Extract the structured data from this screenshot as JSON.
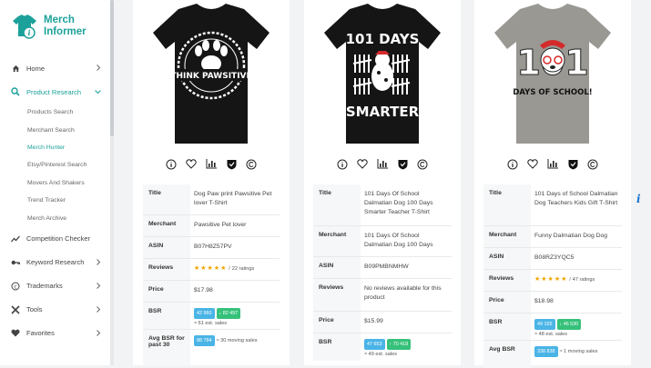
{
  "brand": {
    "line1": "Merch",
    "line2": "Informer",
    "color": "#1ba19a"
  },
  "nav": {
    "home": "Home",
    "product_research": "Product Research",
    "sub": [
      "Products Search",
      "Merchant Search",
      "Merch Hunter",
      "Etsy/Pinterest Search",
      "Movers And Shakers",
      "Trend Tracker",
      "Merch Archive"
    ],
    "competition": "Competition Checker",
    "keyword": "Keyword Research",
    "trademarks": "Trademarks",
    "tools": "Tools",
    "favorites": "Favorites"
  },
  "labels": {
    "title": "Title",
    "merchant": "Merchant",
    "asin": "ASIN",
    "reviews": "Reviews",
    "price": "Price",
    "bsr": "BSR",
    "avg_bsr": "Avg BSR"
  },
  "products": [
    {
      "shirt_color": "#151515",
      "shirt_text_top": "",
      "shirt_text_bottom": "THINK PAWSITIVE",
      "title": "Dog Paw print Pawsitive Pet lover T-Shirt",
      "merchant": "Pawsitive Pet lover",
      "asin": "B07H8Z57PV",
      "review_sep": "/",
      "review_count": "22 ratings",
      "price": "$17.98",
      "bsr_a": "42 960",
      "bsr_b": "↓ 82 497",
      "bsr_sales": "≈ 61 est. sales",
      "avg_badge": "88 784",
      "avg_text": "≈ 30 moving sales",
      "avg_label": "Avg BSR for past 30"
    },
    {
      "shirt_color": "#151515",
      "shirt_text_top": "101 DAYS",
      "shirt_text_bottom": "SMARTER",
      "title": "101 Days Of School Dalmatian Dog 100 Days Smarter Teacher T-Shirt",
      "merchant": "101 Days Of School Dalmatian Dog 100 Days",
      "asin": "B09PMBNMHW",
      "reviews_text": "No reviews available for this product",
      "price": "$15.99",
      "bsr_a": "47 653",
      "bsr_b": "↑ 70 418",
      "bsr_sales": "≈ 49 est. sales"
    },
    {
      "shirt_color": "#9a9893",
      "shirt_text_top": "101",
      "shirt_text_bottom": "DAYS OF SCHOOL!",
      "title": "101 Days of School Dalmatian Dog Teachers Kids Gift T-Shirt",
      "merchant": "Funny Dalmatian Dog Dog",
      "asin": "B08RZ3YQC5",
      "review_sep": "/",
      "review_count": "47 ratings",
      "price": "$18.98",
      "bsr_a": "49 155",
      "bsr_b": "↓ 46 530",
      "bsr_sales": "≈ 48 est. sales",
      "avg_badge": "338 838",
      "avg_text": "≈ 1 moving sales",
      "avg_label": "Avg BSR"
    }
  ],
  "info_mark": "i",
  "icon_names": [
    "info-icon",
    "heart-icon",
    "chart-icon",
    "shield-icon",
    "copyright-icon"
  ]
}
